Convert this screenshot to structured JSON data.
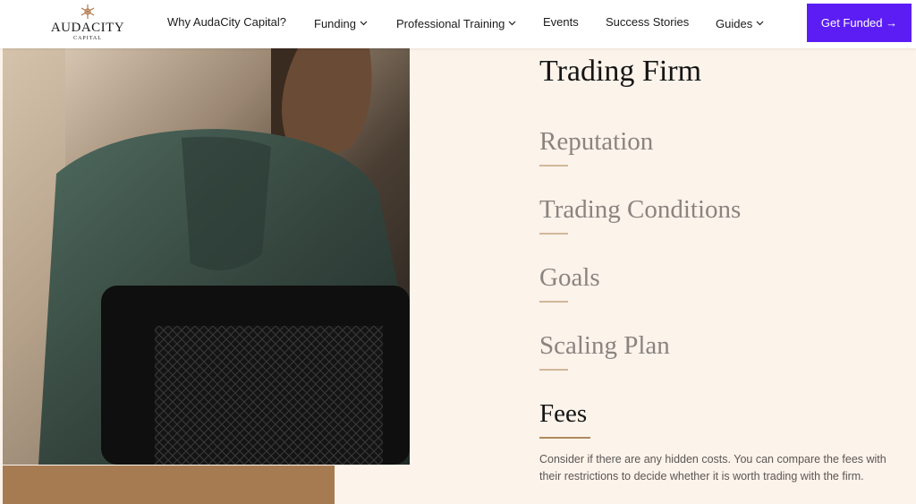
{
  "brand": {
    "name": "AUDACITY",
    "sub": "CAPITAL"
  },
  "nav": {
    "items": [
      {
        "label": "Why AudaCity Capital?",
        "has_dropdown": false
      },
      {
        "label": "Funding",
        "has_dropdown": true
      },
      {
        "label": "Professional Training",
        "has_dropdown": true
      },
      {
        "label": "Events",
        "has_dropdown": false
      },
      {
        "label": "Success Stories",
        "has_dropdown": false
      },
      {
        "label": "Guides",
        "has_dropdown": true
      }
    ],
    "cta_label": "Get Funded →"
  },
  "main": {
    "heading": "Trading Firm",
    "accordion": [
      {
        "title": "Reputation",
        "active": false
      },
      {
        "title": "Trading Conditions",
        "active": false
      },
      {
        "title": "Goals",
        "active": false
      },
      {
        "title": "Scaling Plan",
        "active": false
      },
      {
        "title": "Fees",
        "active": true
      }
    ],
    "active_description": "Consider if there are any hidden costs. You can compare the fees with their restrictions to decide whether it is worth trading with the firm."
  },
  "colors": {
    "accent": "#5c1df5",
    "background": "#fcf3ea",
    "tan": "#a67b52",
    "underline": "#b08a5f"
  }
}
